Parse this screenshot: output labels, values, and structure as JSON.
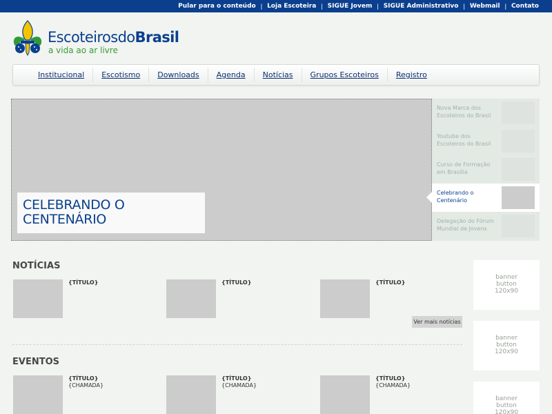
{
  "top_links": [
    "Pular para o conteúdo",
    "Loja Escoteira",
    "SIGUE Jovem",
    "SIGUE Administrativo",
    "Webmail",
    "Contato"
  ],
  "top_separator": "|",
  "logo": {
    "text_part1": "Escoteiros",
    "text_part2": "do",
    "text_part3": "Brasil",
    "slogan": "a vida ao ar livre",
    "colors": {
      "blue": "#0b3f8e",
      "green": "#2e9a3a",
      "yellow": "#f2c500"
    }
  },
  "nav": [
    "Institucional",
    "Escotismo",
    "Downloads",
    "Agenda",
    "Notícias",
    "Grupos Escoteiros",
    "Registro"
  ],
  "hero": {
    "caption_line1": "CELEBRANDO O",
    "caption_line2": "CENTENÁRIO"
  },
  "slides": [
    {
      "line1": "Nova Marca dos",
      "line2": "Escoteiros do Brasil",
      "active": false
    },
    {
      "line1": "Youtube dos",
      "line2": "Escoteiros do Brasil",
      "active": false
    },
    {
      "line1": "Curso de Formação",
      "line2": "em Brasília",
      "active": false
    },
    {
      "line1": "Celebrando o",
      "line2": "Centenário",
      "active": true
    },
    {
      "line1": "Delegação do Fórum",
      "line2": "Mundial de Jovens",
      "active": false
    }
  ],
  "news": {
    "title": "NOTÍCIAS",
    "items": [
      {
        "title": "{TÍTULO}"
      },
      {
        "title": "{TÍTULO}"
      },
      {
        "title": "{TÍTULO}"
      }
    ],
    "more_label": "Ver mais notícias"
  },
  "events": {
    "title": "EVENTOS",
    "items": [
      {
        "title": "{TÍTULO}",
        "sub": "{CHAMADA}"
      },
      {
        "title": "{TÍTULO}",
        "sub": "{CHAMADA}"
      },
      {
        "title": "{TÍTULO}",
        "sub": "{CHAMADA}"
      }
    ]
  },
  "banners": [
    {
      "line1": "banner",
      "line2": "button",
      "line3": "120x90"
    },
    {
      "line1": "banner",
      "line2": "button",
      "line3": "120x90"
    },
    {
      "line1": "banner",
      "line2": "button",
      "line3": "120x90"
    }
  ]
}
